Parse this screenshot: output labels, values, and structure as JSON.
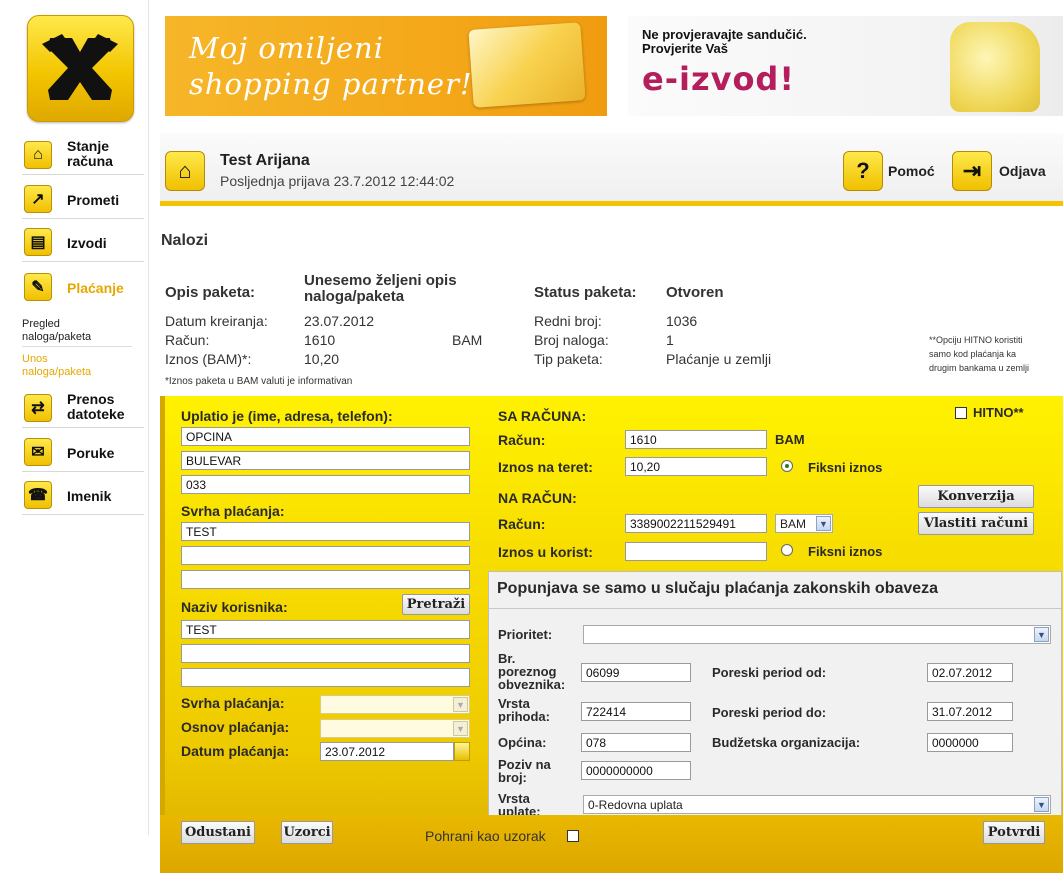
{
  "banners": {
    "shopping": {
      "line1": "Moj omiljeni",
      "line2": "shopping partner!"
    },
    "eizvod": {
      "line1": "Ne provjeravajte sandučić.",
      "line2": "Provjerite Vaš",
      "headline": "e-izvod!"
    }
  },
  "sidebar": {
    "items": [
      {
        "label_line1": "Stanje",
        "label_line2": "računa",
        "icon": "home-icon"
      },
      {
        "label": "Prometi",
        "icon": "chart-arrow-icon"
      },
      {
        "label": "Izvodi",
        "icon": "document-icon"
      },
      {
        "label": "Plaćanje",
        "icon": "payment-icon"
      },
      {
        "label_line1": "Prenos",
        "label_line2": "datoteke",
        "icon": "transfer-icon"
      },
      {
        "label": "Poruke",
        "icon": "envelope-icon"
      },
      {
        "label": "Imenik",
        "icon": "addressbook-icon"
      }
    ],
    "sub_items": [
      {
        "line1": "Pregled",
        "line2": "naloga/paketa"
      },
      {
        "line1": "Unos",
        "line2": "naloga/paketa"
      }
    ]
  },
  "header": {
    "user": "Test Arijana",
    "last_login": "Posljednja prijava 23.7.2012 12:44:02",
    "help": "Pomoć",
    "logout": "Odjava"
  },
  "page_title": "Nalozi",
  "package": {
    "opis_label": "Opis paketa:",
    "opis_value_line1": "Unesemo željeni opis",
    "opis_value_line2": "naloga/paketa",
    "datum_label": "Datum kreiranja:",
    "datum_value": "23.07.2012",
    "racun_label": "Račun:",
    "racun_value": "1610",
    "racun_currency": "BAM",
    "iznos_label": "Iznos (BAM)*:",
    "iznos_value": "10,20",
    "note": "*Iznos paketa u BAM valuti je informativan",
    "status_label": "Status paketa:",
    "status_value": "Otvoren",
    "redni_label": "Redni broj:",
    "redni_value": "1036",
    "broj_label": "Broj naloga:",
    "broj_value": "1",
    "tip_label": "Tip paketa:",
    "tip_value": "Plaćanje u zemlji",
    "hitno_note_1": "**Opciju HITNO koristiti",
    "hitno_note_2": "samo kod plaćanja ka",
    "hitno_note_3": "drugim bankama u zemlji"
  },
  "form": {
    "uplatio_label": "Uplatio je (ime, adresa, telefon):",
    "uplatio_lines": [
      "OPCINA",
      "BULEVAR",
      "033"
    ],
    "svrha_label": "Svrha plaćanja:",
    "svrha_lines": [
      "TEST",
      "",
      ""
    ],
    "naziv_label": "Naziv korisnika:",
    "pretrazi": "Pretraži",
    "naziv_lines": [
      "TEST",
      "",
      ""
    ],
    "svrha_select_label": "Svrha plaćanja:",
    "osnov_label": "Osnov plaćanja:",
    "datum_label": "Datum plaćanja:",
    "datum_value": "23.07.2012",
    "sa_racuna": "SA RAČUNA:",
    "hitno": "HITNO**",
    "racun_label": "Račun:",
    "racun_value": "1610",
    "racun_currency": "BAM",
    "iznos_teret_label": "Iznos na teret:",
    "iznos_teret_value": "10,20",
    "fiksni_1": "Fiksni iznos",
    "konverzija": "Konverzija",
    "na_racun": "NA RAČUN:",
    "na_racun_label": "Račun:",
    "na_racun_value": "3389002211529491",
    "na_racun_currency": "BAM",
    "vlastiti": "Vlastiti računi",
    "iznos_korist_label": "Iznos u korist:",
    "iznos_korist_value": "",
    "fiksni_2": "Fiksni iznos"
  },
  "tax": {
    "title": "Popunjava se samo u slučaju plaćanja zakonskih obaveza",
    "prioritet_label": "Prioritet:",
    "prioritet_value": "",
    "porezni_label_1": "Br.",
    "porezni_label_2": "poreznog",
    "porezni_label_3": "obveznika:",
    "porezni_value": "06099",
    "period_od_label": "Poreski period od:",
    "period_od_value": "02.07.2012",
    "vrsta_prihoda_1": "Vrsta",
    "vrsta_prihoda_2": "prihoda:",
    "vrsta_prihoda_value": "722414",
    "period_do_label": "Poreski period do:",
    "period_do_value": "31.07.2012",
    "opcina_label": "Općina:",
    "opcina_value": "078",
    "budzetska_label": "Budžetska organizacija:",
    "budzetska_value": "0000000",
    "poziv_1": "Poziv na",
    "poziv_2": "broj:",
    "poziv_value": "0000000000",
    "vrsta_uplate_1": "Vrsta",
    "vrsta_uplate_2": "uplate:",
    "vrsta_uplate_value": "0-Redovna uplata"
  },
  "footer": {
    "odustani": "Odustani",
    "uzorci": "Uzorci",
    "pohrani": "Pohrani kao uzorak",
    "potvrdi": "Potvrdi"
  },
  "colors": {
    "brand_yellow": "#f4c400",
    "active_link": "#e6a700",
    "eizvod": "#b51e5c"
  }
}
